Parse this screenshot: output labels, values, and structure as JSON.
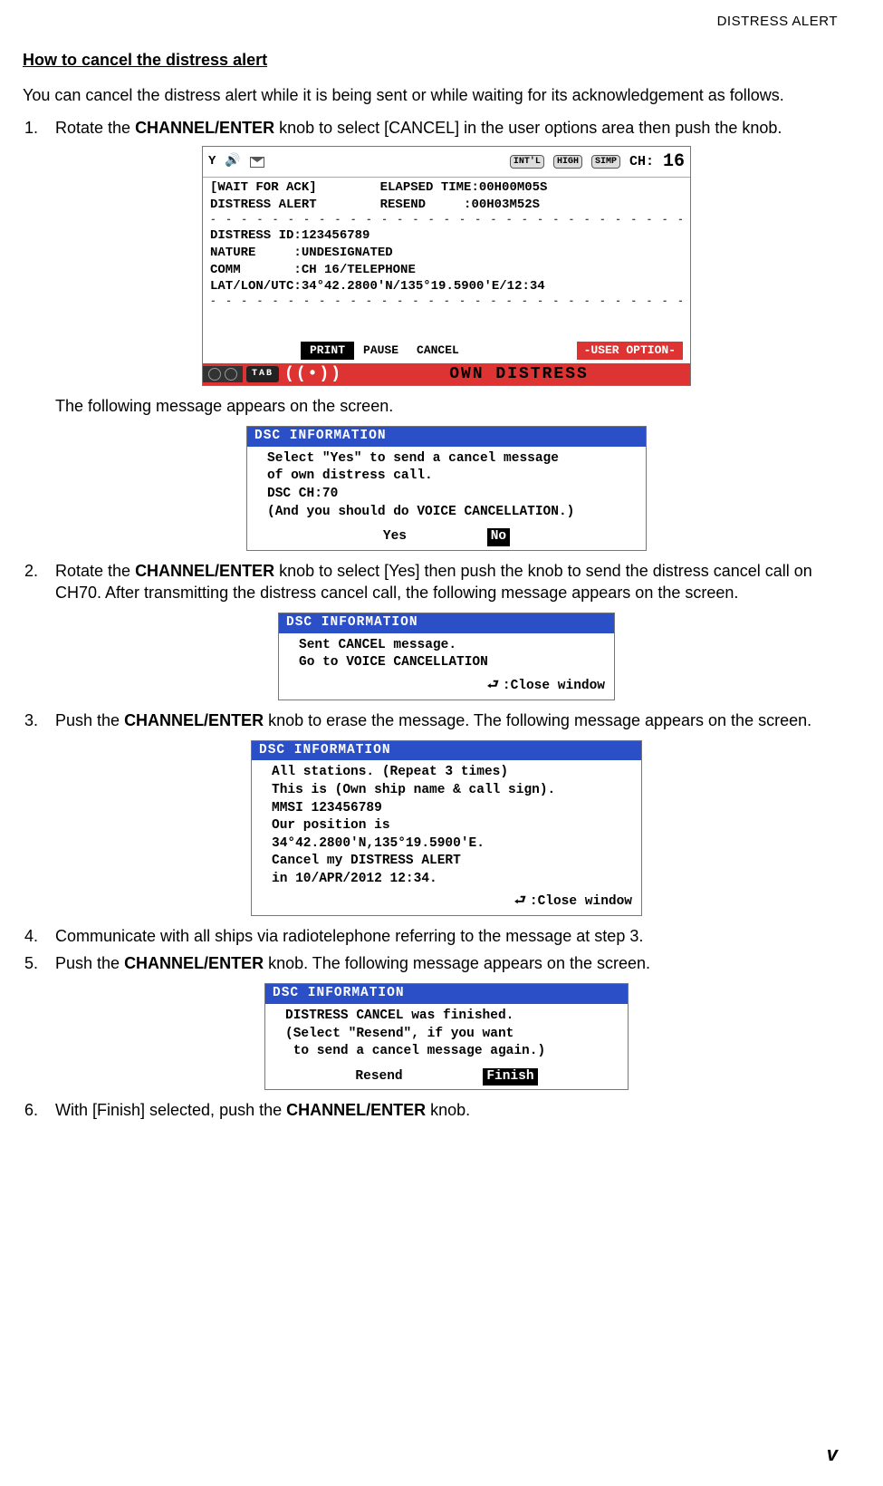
{
  "header": {
    "label": "DISTRESS ALERT"
  },
  "section_title": "How to cancel the distress alert",
  "intro": "You can cancel the distress alert while it is being sent or while waiting for its acknowledgement as follows.",
  "steps": {
    "s1a": "Rotate the ",
    "s1knob": "CHANNEL/ENTER",
    "s1b": " knob to select [CANCEL] in the user options area then push the knob.",
    "s1_after": "The following message appears on the screen.",
    "s2a": "Rotate the ",
    "s2knob": "CHANNEL/ENTER",
    "s2b": " knob to select [Yes] then push the knob to send the distress cancel call on CH70. After transmitting the distress cancel call, the following message appears on the screen.",
    "s3a": "Push the ",
    "s3knob": "CHANNEL/ENTER",
    "s3b": " knob to erase the message. The following message appears on the screen.",
    "s4": "Communicate with all ships via radiotelephone referring to the message at step 3.",
    "s5a": "Push the ",
    "s5knob": "CHANNEL/ENTER",
    "s5b": " knob. The following message appears on the screen.",
    "s6a": "With [Finish] selected, push the ",
    "s6knob": "CHANNEL/ENTER",
    "s6b": " knob."
  },
  "device": {
    "status": {
      "pill_intl": "INT'L",
      "pill_high": "HIGH",
      "pill_simp": "SIMP",
      "ch_label": "CH:",
      "ch_value": "16"
    },
    "row1_l": "[WAIT FOR ACK]",
    "row1_r": "ELAPSED TIME:00H00M05S",
    "row2_l": "DISTRESS ALERT",
    "row2_r": "RESEND     :00H03M52S",
    "distress_id_l": "DISTRESS ID:",
    "distress_id_v": "123456789",
    "nature_l": "NATURE     :",
    "nature_v": "UNDESIGNATED",
    "comm_l": "COMM       :",
    "comm_v": "CH 16/TELEPHONE",
    "lat_l": "LAT/LON/UTC:",
    "lat_v": "34°42.2800'N/135°19.5900'E/12:34",
    "options": {
      "print": "PRINT",
      "pause": "PAUSE",
      "cancel": "CANCEL",
      "user": "-USER OPTION-"
    },
    "tab": "TAB",
    "own_distress": "OWN DISTRESS"
  },
  "dsc1": {
    "title": "DSC INFORMATION",
    "l1": "Select \"Yes\" to send a cancel message",
    "l2": "of own distress call.",
    "l3": "DSC CH:70",
    "l4": "(And you should do VOICE CANCELLATION.)",
    "yes": "Yes",
    "no": "No"
  },
  "dsc2": {
    "title": "DSC INFORMATION",
    "l1": "Sent CANCEL message.",
    "l2": "Go to VOICE CANCELLATION",
    "close": ":Close window"
  },
  "dsc3": {
    "title": "DSC INFORMATION",
    "l1": "All stations. (Repeat 3 times)",
    "l2": "This is (Own ship name & call sign).",
    "l3": "MMSI 123456789",
    "l4": "Our position is",
    "l5": "34°42.2800'N,135°19.5900'E.",
    "l6": "Cancel my DISTRESS ALERT",
    "l7": "in 10/APR/2012 12:34.",
    "close": ":Close window"
  },
  "dsc4": {
    "title": "DSC INFORMATION",
    "l1": "DISTRESS CANCEL was finished.",
    "l2": "(Select \"Resend\", if you want",
    "l3": " to send a cancel message again.)",
    "resend": "Resend",
    "finish": "Finish"
  },
  "page_number": "v"
}
